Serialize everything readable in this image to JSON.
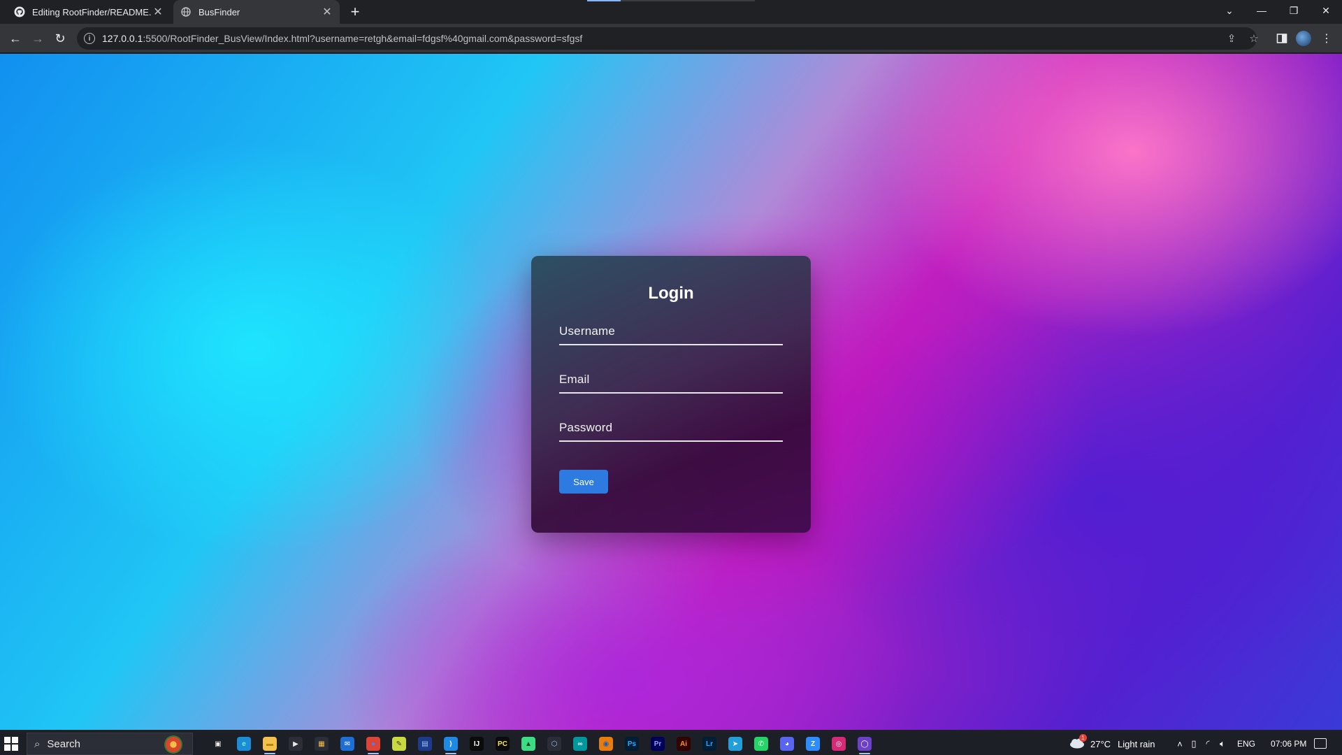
{
  "browser": {
    "tabs": [
      {
        "title": "Editing RootFinder/README.md",
        "icon": "github-icon",
        "active": false
      },
      {
        "title": "BusFinder",
        "icon": "globe-icon",
        "active": true
      }
    ],
    "url_host": "127.0.0.1",
    "url_rest": ":5500/RootFinder_BusView/Index.html?username=retgh&email=fdgsf%40gmail.com&password=sfgsf"
  },
  "login": {
    "title": "Login",
    "username_placeholder": "Username",
    "email_placeholder": "Email",
    "password_placeholder": "Password",
    "save_label": "Save"
  },
  "taskbar": {
    "search_label": "Search",
    "weather": "27°C",
    "weather_desc": "Light rain",
    "language": "ENG",
    "time": "07:06 PM",
    "weather_badge": "1",
    "apps": [
      "task-view-icon",
      "edge-icon",
      "file-explorer-icon",
      "media-player-icon",
      "store-icon",
      "mail-icon",
      "chrome-icon",
      "notepad-icon",
      "visual-studio-icon",
      "vscode-icon",
      "intellij-icon",
      "pycharm-icon",
      "android-studio-icon",
      "virtualbox-icon",
      "arduino-icon",
      "blender-icon",
      "photoshop-icon",
      "premiere-icon",
      "illustrator-icon",
      "lightroom-icon",
      "telegram-icon",
      "whatsapp-icon",
      "discord-icon",
      "zoom-icon",
      "instagram-icon",
      "github-desktop-icon"
    ]
  },
  "colors": {
    "accent_button": "#2d7be0",
    "card_text": "#ffffff"
  }
}
